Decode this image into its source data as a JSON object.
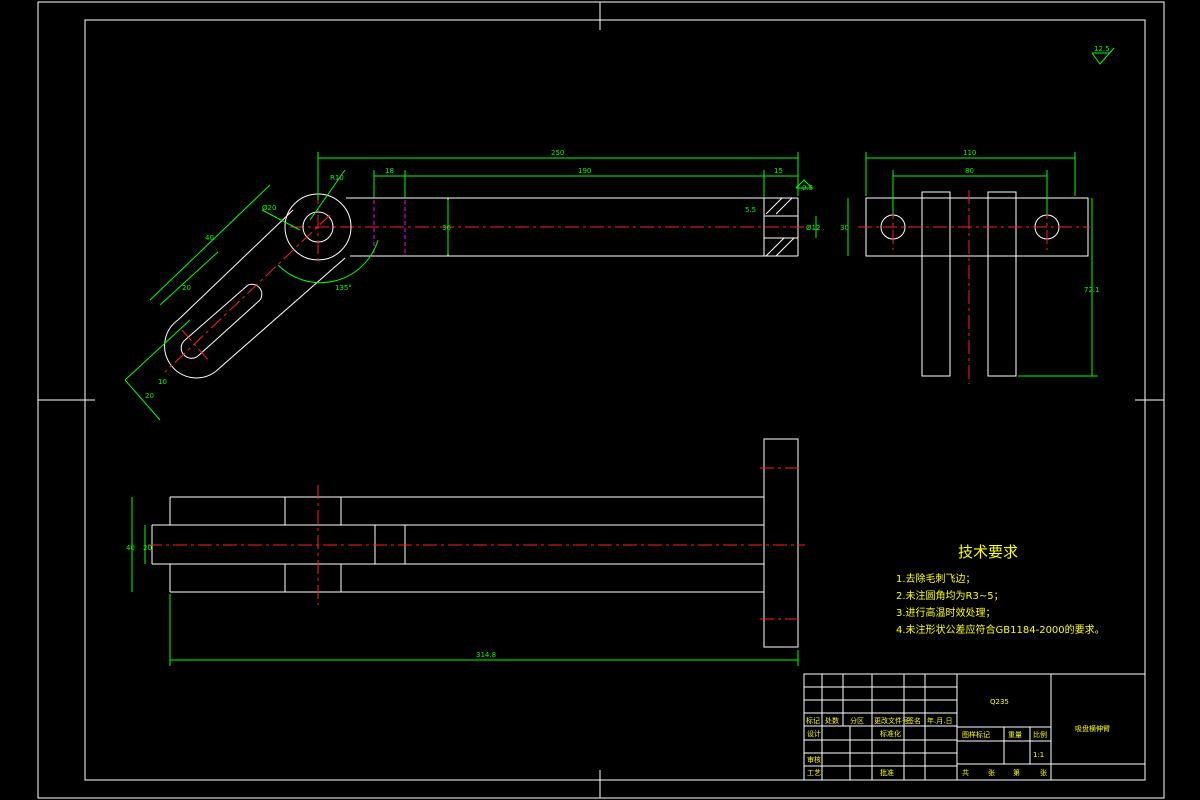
{
  "dimensions": {
    "overall_length": "250",
    "hole_dia": "Ø20",
    "small_radius": "R10",
    "offset_left": "18",
    "mid_length": "190",
    "offset_right": "15",
    "bar_height": "30",
    "end_dia": "Ø12",
    "chamfer": "0.5",
    "groove": "5.5",
    "arm_dia": "Ø20",
    "arm_len_outer": "40",
    "arm_slot": "20",
    "arm_end_a": "10",
    "arm_end_b": "20",
    "angle": "135°",
    "side_width": "110",
    "side_pitch": "80",
    "side_height": "30",
    "side_depth": "72.1",
    "bottom_h1": "40",
    "bottom_h2": "20",
    "bottom_length": "314.8",
    "roughness": "12.5"
  },
  "tech_requirements": {
    "title": "技术要求",
    "items": [
      "1.去除毛刺飞边；",
      "2.未注圆角均为R3~5；",
      "3.进行高温时效处理；",
      "4.未注形状公差应符合GB1184-2000的要求。"
    ]
  },
  "title_block": {
    "material": "Q235",
    "part_name": "吸盘横伸臂",
    "scale": "1:1",
    "stage_mark": "图样标记",
    "weight": "重量",
    "scale_label": "比例",
    "labels": [
      "标记",
      "处数",
      "分区",
      "更改文件号",
      "签名",
      "年.月.日"
    ],
    "design": "设计",
    "standardize": "标准化",
    "check": "审核",
    "process": "工艺",
    "approve": "批准",
    "sheet_total": "共",
    "sheet_unit": "张",
    "sheet_no": "第",
    "sheet_unit2": "张"
  }
}
